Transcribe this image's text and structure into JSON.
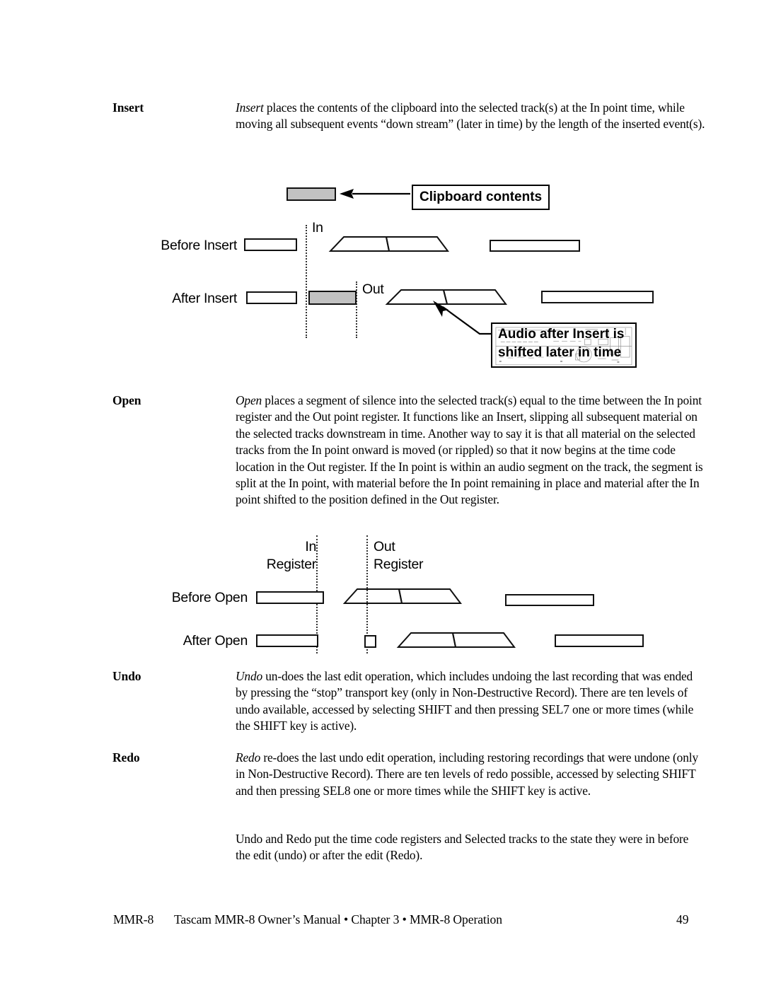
{
  "document": {
    "sections": [
      {
        "term": "Insert",
        "body": [
          {
            "italic": "Insert",
            "rest": " places the contents of the clipboard into the selected track(s) at the In point time, while moving all subsequent events “down stream” (later in time) by the length of the inserted event(s)."
          }
        ]
      },
      {
        "term": "Open",
        "body": [
          {
            "italic": "Open",
            "rest": " places a segment of silence into the selected track(s) equal to the time between the In point register and the Out point register.  It functions like an Insert, slipping all subsequent material on the selected tracks downstream in time. Another way to say it is that all material on the selected tracks from the In point onward is moved (or rippled) so that it now begins at the time code location in the Out register. If the In point is within an audio segment on the track, the segment is split at the In point, with material before the In point remaining in place and material after the In point shifted to the position defined in the Out register."
          }
        ]
      },
      {
        "term": "Undo",
        "body": [
          {
            "italic": "Undo",
            "rest": " un-does the last edit operation, which includes undoing the last recording that was ended by pressing the “stop” transport key (only in Non-Destructive Record). There are ten levels of undo available, accessed by selecting SHIFT and then pressing SEL7 one or more times (while the SHIFT key is active)."
          }
        ]
      },
      {
        "term": "Redo",
        "body": [
          {
            "italic": "Redo",
            "rest": " re-does the last undo edit operation, including restoring recordings that were undone (only in Non-Destructive Record). There are ten levels of redo possible, accessed by selecting SHIFT and then pressing SEL8 one or more times while the SHIFT key is active."
          }
        ]
      },
      {
        "term": "",
        "body": [
          {
            "italic": "",
            "rest": "Undo and Redo put the time code registers and Selected tracks to the state they were in before the edit (undo) or after the edit (Redo)."
          }
        ]
      }
    ]
  },
  "figure_insert": {
    "name": "insert-diagram",
    "clipboard_callout": "Clipboard contents",
    "shift_callout_line1": "Audio after Insert is",
    "shift_callout_line2": "shifted later in time",
    "row_before_label": "Before Insert",
    "row_after_label": "After Insert",
    "marker_in": "In",
    "marker_out": "Out"
  },
  "figure_open": {
    "name": "open-diagram",
    "in_register_line1": "In",
    "in_register_line2": "Register",
    "out_register_line1": "Out",
    "out_register_line2": "Register",
    "row_before_label": "Before Open",
    "row_after_label": "After Open"
  },
  "footer": {
    "left": "MMR-8",
    "center": "Tascam MMR-8 Owner’s Manual • Chapter 3 • MMR-8 Operation",
    "page_number": "49"
  },
  "colors": {
    "ink": "#000000",
    "clip_fill": "#c2c2c2",
    "guide": "#333333",
    "paper": "#ffffff"
  }
}
